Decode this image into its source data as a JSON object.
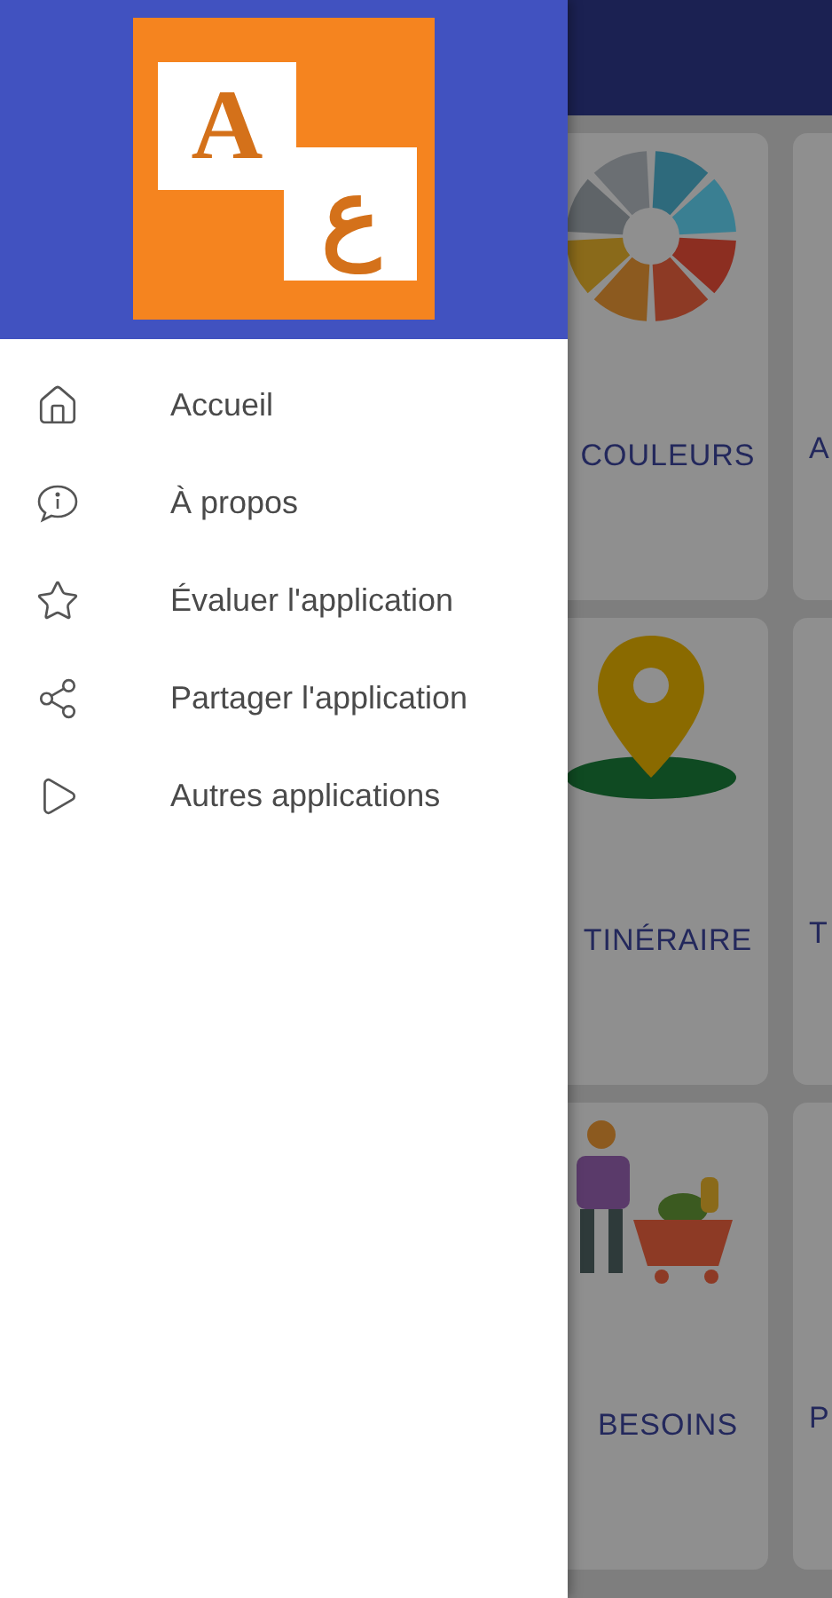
{
  "drawer": {
    "logo": {
      "letter_left": "A",
      "letter_right": "ع"
    },
    "items": [
      {
        "label": "Accueil",
        "kind": "home"
      },
      {
        "label": "À propos",
        "kind": "info"
      },
      {
        "label": "Évaluer l'application",
        "kind": "star"
      },
      {
        "label": "Partager l'application",
        "kind": "share"
      },
      {
        "label": "Autres applications",
        "kind": "play"
      }
    ]
  },
  "background": {
    "cards": [
      {
        "label": "COULEURS",
        "kind": "wheel",
        "side_label": "A"
      },
      {
        "label": "TINÉRAIRE",
        "kind": "pin",
        "side_label": "T"
      },
      {
        "label": "BESOINS",
        "kind": "shopper",
        "side_label": "P"
      }
    ]
  }
}
